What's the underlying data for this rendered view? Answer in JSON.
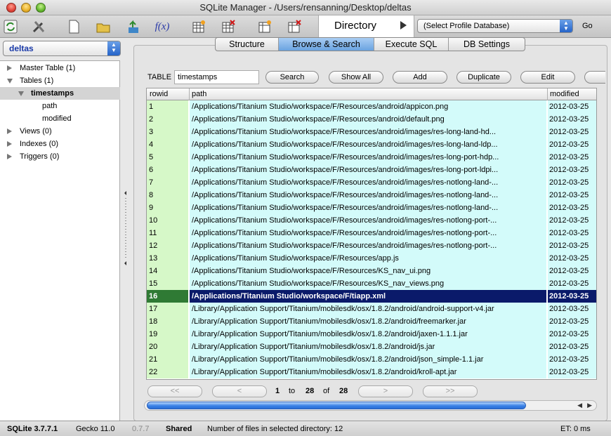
{
  "window": {
    "title": "SQLite Manager - /Users/rensanning/Desktop/deltas"
  },
  "toolbar": {
    "directory_label": "Directory",
    "profile_select": "(Select Profile Database)",
    "go_label": "Go",
    "fx_label": "f(x)"
  },
  "sidebar": {
    "db_select": "deltas",
    "tree": [
      {
        "label": "Master Table (1)",
        "state": "closed",
        "level": 0
      },
      {
        "label": "Tables (1)",
        "state": "open",
        "level": 0
      },
      {
        "label": "timestamps",
        "state": "open",
        "level": 1
      },
      {
        "label": "path",
        "state": "leaf",
        "level": 2
      },
      {
        "label": "modified",
        "state": "leaf",
        "level": 2
      },
      {
        "label": "Views (0)",
        "state": "closed",
        "level": 0
      },
      {
        "label": "Indexes (0)",
        "state": "closed",
        "level": 0
      },
      {
        "label": "Triggers (0)",
        "state": "closed",
        "level": 0
      }
    ]
  },
  "tabs": [
    {
      "label": "Structure"
    },
    {
      "label": "Browse & Search"
    },
    {
      "label": "Execute SQL"
    },
    {
      "label": "DB Settings"
    }
  ],
  "browse": {
    "table_label": "TABLE",
    "table_value": "timestamps",
    "buttons": {
      "search": "Search",
      "show_all": "Show All",
      "add": "Add",
      "duplicate": "Duplicate",
      "edit": "Edit"
    },
    "columns": [
      "rowid",
      "path",
      "modified"
    ],
    "rows": [
      {
        "rowid": "1",
        "path": "/Applications/Titanium Studio/workspace/F/Resources/android/appicon.png",
        "modified": "2012-03-25"
      },
      {
        "rowid": "2",
        "path": "/Applications/Titanium Studio/workspace/F/Resources/android/default.png",
        "modified": "2012-03-25"
      },
      {
        "rowid": "3",
        "path": "/Applications/Titanium Studio/workspace/F/Resources/android/images/res-long-land-hd...",
        "modified": "2012-03-25"
      },
      {
        "rowid": "4",
        "path": "/Applications/Titanium Studio/workspace/F/Resources/android/images/res-long-land-ldp...",
        "modified": "2012-03-25"
      },
      {
        "rowid": "5",
        "path": "/Applications/Titanium Studio/workspace/F/Resources/android/images/res-long-port-hdp...",
        "modified": "2012-03-25"
      },
      {
        "rowid": "6",
        "path": "/Applications/Titanium Studio/workspace/F/Resources/android/images/res-long-port-ldpi...",
        "modified": "2012-03-25"
      },
      {
        "rowid": "7",
        "path": "/Applications/Titanium Studio/workspace/F/Resources/android/images/res-notlong-land-...",
        "modified": "2012-03-25"
      },
      {
        "rowid": "8",
        "path": "/Applications/Titanium Studio/workspace/F/Resources/android/images/res-notlong-land-...",
        "modified": "2012-03-25"
      },
      {
        "rowid": "9",
        "path": "/Applications/Titanium Studio/workspace/F/Resources/android/images/res-notlong-land-...",
        "modified": "2012-03-25"
      },
      {
        "rowid": "10",
        "path": "/Applications/Titanium Studio/workspace/F/Resources/android/images/res-notlong-port-...",
        "modified": "2012-03-25"
      },
      {
        "rowid": "11",
        "path": "/Applications/Titanium Studio/workspace/F/Resources/android/images/res-notlong-port-...",
        "modified": "2012-03-25"
      },
      {
        "rowid": "12",
        "path": "/Applications/Titanium Studio/workspace/F/Resources/android/images/res-notlong-port-...",
        "modified": "2012-03-25"
      },
      {
        "rowid": "13",
        "path": "/Applications/Titanium Studio/workspace/F/Resources/app.js",
        "modified": "2012-03-25"
      },
      {
        "rowid": "14",
        "path": "/Applications/Titanium Studio/workspace/F/Resources/KS_nav_ui.png",
        "modified": "2012-03-25"
      },
      {
        "rowid": "15",
        "path": "/Applications/Titanium Studio/workspace/F/Resources/KS_nav_views.png",
        "modified": "2012-03-25"
      },
      {
        "rowid": "16",
        "path": "/Applications/Titanium Studio/workspace/F/tiapp.xml",
        "modified": "2012-03-25",
        "selected": true
      },
      {
        "rowid": "17",
        "path": "/Library/Application Support/Titanium/mobilesdk/osx/1.8.2/android/android-support-v4.jar",
        "modified": "2012-03-25"
      },
      {
        "rowid": "18",
        "path": "/Library/Application Support/Titanium/mobilesdk/osx/1.8.2/android/freemarker.jar",
        "modified": "2012-03-25"
      },
      {
        "rowid": "19",
        "path": "/Library/Application Support/Titanium/mobilesdk/osx/1.8.2/android/jaxen-1.1.1.jar",
        "modified": "2012-03-25"
      },
      {
        "rowid": "20",
        "path": "/Library/Application Support/Titanium/mobilesdk/osx/1.8.2/android/js.jar",
        "modified": "2012-03-25"
      },
      {
        "rowid": "21",
        "path": "/Library/Application Support/Titanium/mobilesdk/osx/1.8.2/android/json_simple-1.1.jar",
        "modified": "2012-03-25"
      },
      {
        "rowid": "22",
        "path": "/Library/Application Support/Titanium/mobilesdk/osx/1.8.2/android/kroll-apt.jar",
        "modified": "2012-03-25"
      }
    ],
    "pager": {
      "first": "<<",
      "prev": "<",
      "from": "1",
      "to_word": "to",
      "to": "28",
      "of_word": "of",
      "total": "28",
      "next": ">",
      "last": ">>"
    }
  },
  "status": {
    "sqlite": "SQLite 3.7.7.1",
    "gecko": "Gecko 11.0",
    "version": "0.7.7",
    "shared": "Shared",
    "message": "Number of files in selected directory: 12",
    "et": "ET: 0 ms"
  }
}
